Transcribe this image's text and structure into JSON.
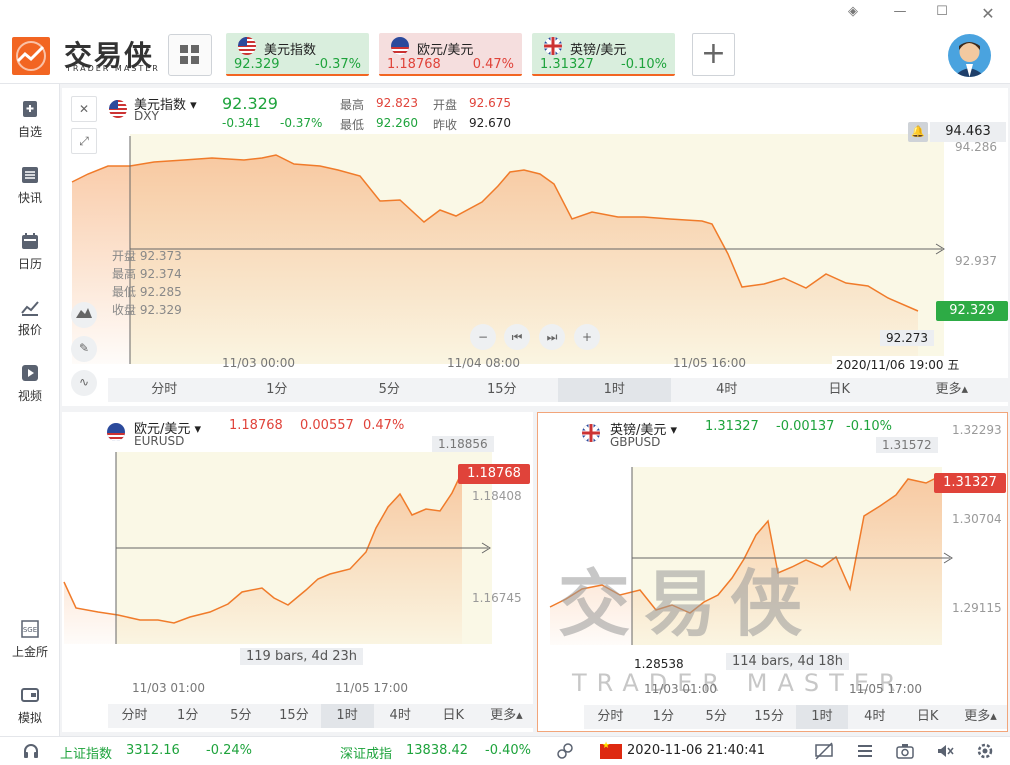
{
  "app": {
    "logo_cn": "交易侠",
    "logo_en": "TRADER MASTER"
  },
  "tabs": [
    {
      "name": "美元指数",
      "price": "92.329",
      "change": "-0.37%",
      "dir": "dn"
    },
    {
      "name": "欧元/美元",
      "price": "1.18768",
      "change": "0.47%",
      "dir": "up"
    },
    {
      "name": "英镑/美元",
      "price": "1.31327",
      "change": "-0.10%",
      "dir": "dn"
    }
  ],
  "nav": {
    "watchlist": "自选",
    "news": "快讯",
    "calendar": "日历",
    "report": "报价",
    "video": "视频",
    "sge": "上金所",
    "sim": "模拟"
  },
  "main": {
    "name": "美元指数",
    "code": "DXY",
    "price": "92.329",
    "chg": "-0.341",
    "pct": "-0.37%",
    "high_l": "最高",
    "high": "92.823",
    "open_l": "开盘",
    "open": "92.675",
    "low_l": "最低",
    "low": "92.260",
    "prev_l": "昨收",
    "prev": "92.670",
    "ohlc": {
      "open": "开盘 92.373",
      "high": "最高 92.374",
      "low": "最低 92.285",
      "close": "收盘 92.329"
    },
    "cursor_price": "94.463",
    "y_ticks": [
      "94.286",
      "92.937"
    ],
    "last_tag": "92.329",
    "hover_price": "92.273",
    "hover_time": "2020/11/06 19:00 五",
    "x_ticks": [
      "11/03 00:00",
      "11/04 08:00",
      "11/05 16:00"
    ],
    "periods": [
      "分时",
      "1分",
      "5分",
      "15分",
      "1时",
      "4时",
      "日K",
      "更多▴"
    ],
    "selected": 4
  },
  "eur": {
    "name": "欧元/美元",
    "code": "EURUSD",
    "price": "1.18768",
    "chg": "0.00557",
    "pct": "0.47%",
    "top_tag": "1.18856",
    "last_tag": "1.18768",
    "y_ticks": [
      "1.18408",
      "1.16745"
    ],
    "bars": "119 bars, 4d 23h",
    "x_ticks": [
      "11/03 01:00",
      "11/05 17:00"
    ],
    "periods": [
      "分时",
      "1分",
      "5分",
      "15分",
      "1时",
      "4时",
      "日K",
      "更多▴"
    ],
    "selected": 4
  },
  "gbp": {
    "name": "英镑/美元",
    "code": "GBPUSD",
    "price": "1.31327",
    "chg": "-0.00137",
    "pct": "-0.10%",
    "top_tag": "1.31572",
    "last_tag": "1.31327",
    "y_ticks": [
      "1.32293",
      "1.30704",
      "1.29115"
    ],
    "low_tag": "1.28538",
    "bars": "114 bars, 4d 18h",
    "x_ticks": [
      "11/03 01:00",
      "11/05 17:00"
    ],
    "periods": [
      "分时",
      "1分",
      "5分",
      "15分",
      "1时",
      "4时",
      "日K",
      "更多▴"
    ],
    "selected": 4
  },
  "status": {
    "idx1_name": "上证指数",
    "idx1_val": "3312.16",
    "idx1_chg": "-0.24%",
    "idx2_name": "深证成指",
    "idx2_val": "13838.42",
    "idx2_chg": "-0.40%",
    "time": "2020-11-06 21:40:41"
  },
  "colors": {
    "accent": "#f26522",
    "up": "#e0433a",
    "down": "#1ea33c"
  }
}
